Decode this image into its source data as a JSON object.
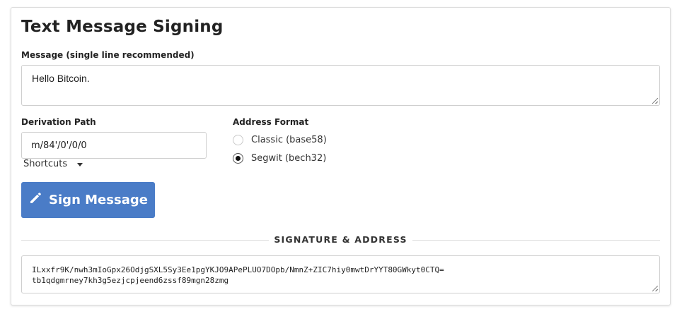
{
  "title": "Text Message Signing",
  "message": {
    "label": "Message (single line recommended)",
    "value": "Hello Bitcoin."
  },
  "derivation": {
    "label": "Derivation Path",
    "value": "m/84'/0'/0/0",
    "shortcuts_label": "Shortcuts"
  },
  "address_format": {
    "label": "Address Format",
    "options": [
      {
        "label": "Classic (base58)",
        "checked": false
      },
      {
        "label": "Segwit (bech32)",
        "checked": true
      }
    ]
  },
  "sign_button": {
    "label": "Sign Message",
    "icon": "pencil-icon"
  },
  "result": {
    "section_label": "SIGNATURE & ADDRESS",
    "signature": "ILxxfr9K/nwh3mIoGpx26OdjgSXL5Sy3Ee1pgYKJO9APePLUO7DOpb/NmnZ+ZIC7hiy0mwtDrYYT80GWkyt0CTQ=",
    "address": "tb1qdgmrney7kh3g5ezjcpjeend6zssf89mgn28zmg"
  },
  "colors": {
    "primary": "#4a7cc7",
    "border": "#cfcfcf"
  }
}
